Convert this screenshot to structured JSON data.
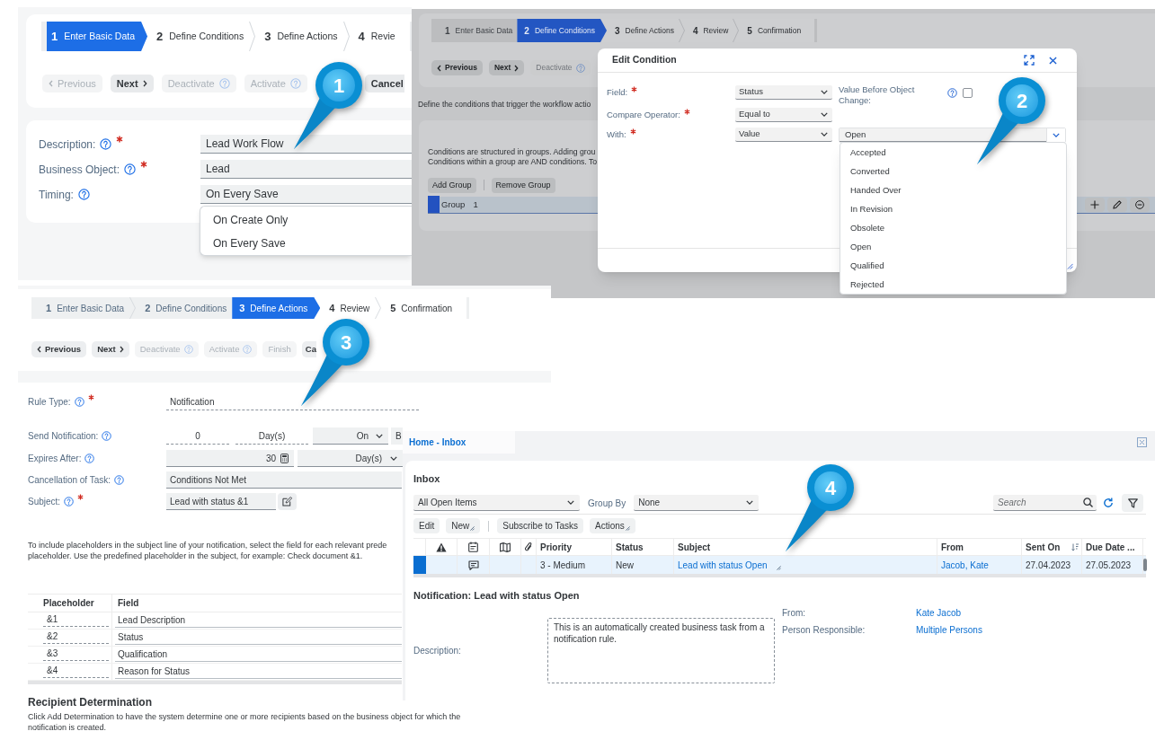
{
  "basic_data_screen": {
    "steps": [
      {
        "number": "1",
        "label": "Enter Basic Data",
        "selected": true
      },
      {
        "number": "2",
        "label": "Define Conditions",
        "selected": false
      },
      {
        "number": "3",
        "label": "Define Actions",
        "selected": false
      },
      {
        "number": "4",
        "label": "Revie",
        "selected": false
      }
    ],
    "buttons": [
      {
        "label": "Previous",
        "kind": "back",
        "disabled": true
      },
      {
        "label": "Next",
        "kind": "forward",
        "disabled": false
      },
      {
        "label": "Deactivate",
        "kind": "help",
        "disabled": true
      },
      {
        "label": "Activate",
        "kind": "help",
        "disabled": true
      },
      {
        "label": "Cancel",
        "kind": "plain",
        "disabled": false
      }
    ],
    "fields": [
      {
        "label": "Description:",
        "required": true,
        "value": "Lead Work Flow"
      },
      {
        "label": "Business Object:",
        "required": true,
        "value": "Lead"
      },
      {
        "label": "Timing:",
        "required": false,
        "value": "On Every Save"
      }
    ],
    "timing_options": [
      "On Create Only",
      "On Every Save"
    ]
  },
  "conditions_screen": {
    "steps": [
      {
        "number": "1",
        "label": "Enter Basic Data",
        "selected": false
      },
      {
        "number": "2",
        "label": "Define Conditions",
        "selected": true
      },
      {
        "number": "3",
        "label": "Define Actions",
        "selected": false
      },
      {
        "number": "4",
        "label": "Review",
        "selected": false
      },
      {
        "number": "5",
        "label": "Confirmation",
        "selected": false
      }
    ],
    "buttons": [
      {
        "label": "Previous",
        "kind": "back",
        "disabled": false
      },
      {
        "label": "Next",
        "kind": "forward",
        "disabled": false
      },
      {
        "label": "Deactivate",
        "kind": "help",
        "disabled": true
      }
    ],
    "intro": "Define the conditions that trigger the workflow actio",
    "group_info": [
      "Conditions are structured in groups. Adding grou",
      "Conditions within a group are AND conditions. To"
    ],
    "group_buttons": [
      "Add Group",
      "Remove Group"
    ],
    "group": {
      "label": "Group",
      "number": "1"
    },
    "dialog": {
      "title": "Edit Condition",
      "fields": [
        {
          "label": "Field:",
          "required": true,
          "value": "Status"
        },
        {
          "label": "Compare Operator:",
          "required": true,
          "value": "Equal to"
        },
        {
          "label": "With:",
          "required": true,
          "value": "Value"
        }
      ],
      "value_before_change": {
        "label": "Value Before Object Change:",
        "checked": false
      },
      "comparison_value": "Open",
      "value_options": [
        "Accepted",
        "Converted",
        "Handed Over",
        "In Revision",
        "Obsolete",
        "Open",
        "Qualified",
        "Rejected"
      ]
    }
  },
  "actions_screen": {
    "steps": [
      {
        "number": "1",
        "label": "Enter Basic Data",
        "selected": false
      },
      {
        "number": "2",
        "label": "Define Conditions",
        "selected": false
      },
      {
        "number": "3",
        "label": "Define Actions",
        "selected": true
      },
      {
        "number": "4",
        "label": "Review",
        "selected": false
      },
      {
        "number": "5",
        "label": "Confirmation",
        "selected": false
      }
    ],
    "buttons": [
      {
        "label": "Previous",
        "kind": "back",
        "disabled": false
      },
      {
        "label": "Next",
        "kind": "forward",
        "disabled": false
      },
      {
        "label": "Deactivate",
        "kind": "help",
        "disabled": true
      },
      {
        "label": "Activate",
        "kind": "help",
        "disabled": true
      },
      {
        "label": "Finish",
        "kind": "plain",
        "disabled": true
      },
      {
        "label": "Ca",
        "kind": "plain",
        "disabled": false
      }
    ],
    "rule_type": {
      "label": "Rule Type:",
      "required": true,
      "value": "Notification"
    },
    "send_notification": {
      "label": "Send Notification:",
      "required": false,
      "amount": "0",
      "unit": "Day(s)",
      "timing": "On",
      "reference": "B"
    },
    "expires_after": {
      "label": "Expires After:",
      "required": false,
      "amount": "30",
      "unit": "Day(s)"
    },
    "cancellation": {
      "label": "Cancellation of Task:",
      "required": false,
      "value": "Conditions Not Met"
    },
    "subject": {
      "label": "Subject:",
      "required": true,
      "value": "Lead with status &1"
    },
    "placeholder_info": [
      "To include placeholders in the subject line of your notification, select the field for each relevant prede",
      "placeholder. Use the predefined placeholder in the subject, for example: Check document &1."
    ],
    "placeholder_table": {
      "columns": [
        "Placeholder",
        "Field"
      ],
      "rows": [
        [
          "&1",
          "Lead Description"
        ],
        [
          "&2",
          "Status"
        ],
        [
          "&3",
          "Qualification"
        ],
        [
          "&4",
          "Reason for Status"
        ]
      ]
    },
    "recipient_heading": "Recipient Determination",
    "recipient_info": "Click Add Determination to have the system determine one or more recipients based on the business object for which the notification is created."
  },
  "inbox_screen": {
    "tab": "Home - Inbox",
    "title": "Inbox",
    "view": "All Open Items",
    "group_by": {
      "label": "Group By",
      "value": "None"
    },
    "search": {
      "placeholder": "Search"
    },
    "toolbar": [
      {
        "label": "Edit",
        "menu": false
      },
      {
        "label": "New",
        "menu": true
      },
      {
        "label": "Subscribe to Tasks",
        "menu": false
      },
      {
        "label": "Actions",
        "menu": true
      }
    ],
    "table": {
      "columns": [
        {
          "label": "Priority",
          "kind": "text",
          "sorted": false
        },
        {
          "label": "Status",
          "kind": "text",
          "sorted": false
        },
        {
          "label": "Subject",
          "kind": "menulink",
          "sorted": false
        },
        {
          "label": "From",
          "kind": "link",
          "sorted": false
        },
        {
          "label": "Sent On",
          "kind": "text",
          "sorted": true
        },
        {
          "label": "Due Date ...",
          "kind": "text",
          "sorted": false
        }
      ],
      "rows": [
        {
          "selected": true,
          "note": true,
          "cells": [
            "3 - Medium",
            "New",
            "Lead with status Open",
            "Jacob, Kate",
            "27.04.2023",
            "27.05.2023"
          ]
        }
      ]
    },
    "detail": {
      "title": "Notification: Lead with status Open",
      "description_label": "Description:",
      "description": "This is an automatically created business task from a notification rule.",
      "from_label": "From:",
      "from": "Kate Jacob",
      "responsible_label": "Person Responsible:",
      "responsible": "Multiple Persons"
    }
  },
  "callouts": [
    {
      "number": "1"
    },
    {
      "number": "2"
    },
    {
      "number": "3"
    },
    {
      "number": "4"
    }
  ]
}
